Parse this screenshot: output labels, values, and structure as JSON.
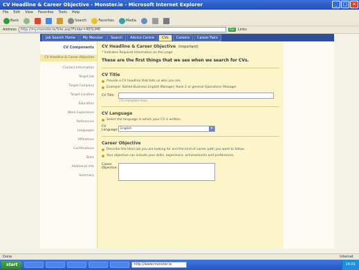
{
  "window": {
    "title": "CV Headline & Career Objective - Monster.ie - Microsoft Internet Explorer"
  },
  "menu": [
    "File",
    "Edit",
    "View",
    "Favorites",
    "Tools",
    "Help"
  ],
  "toolbar": {
    "back": "Back",
    "search": "Search",
    "favorites": "Favorites",
    "media": "Media"
  },
  "address": {
    "label": "Address",
    "value": "http://my.monster.ie/Site.asp?Folder=RESUME",
    "go": "Go",
    "links": "Links"
  },
  "nav": {
    "tabs": [
      "Job Search Home",
      "My Monster",
      "Search",
      "Advice Centre",
      "CVs",
      "Careers",
      "Career Fairs"
    ],
    "active_index": 4
  },
  "left": {
    "items": [
      "CV Components",
      "CV Headline & Career Objective",
      "Contact Information",
      "Target Job",
      "Target Company",
      "Target Location",
      "Education",
      "Work Experience",
      "References",
      "Languages",
      "Affiliations",
      "Certifications",
      "Skills",
      "Additional Info",
      "Summary"
    ],
    "current_index": 1
  },
  "main": {
    "section_title": "CV Headline & Career Objective",
    "section_hint": "(Important)",
    "required_note": "* Indicates Required Information on this page",
    "intro": "These are the first things that we see when we search for CVs.",
    "cv_title": {
      "heading": "CV Title",
      "bullets": [
        "Provide a CV headline that tells us who you are.",
        "Example: Skilled Business English Manager; Rank 2 or general Operations Manager"
      ],
      "field_label": "CV Title:",
      "hint": "(70 characters max)"
    },
    "cv_language": {
      "heading": "CV Language",
      "bullets": [
        "Select the language in which your CV is written."
      ],
      "field_label": "CV Language:",
      "selected": "English"
    },
    "career_objective": {
      "heading": "Career Objective",
      "bullets": [
        "Describe the ideal job you are looking for and the kind of career path you want to follow.",
        "Your objective can include your skills, experience, achievements and preferences."
      ],
      "field_label": "Career Objective:"
    }
  },
  "statusbar": {
    "text": "Done",
    "zone": "Internet"
  },
  "taskbar": {
    "start": "start",
    "address_item": "http://www.monster.ie",
    "clock": "14:01"
  },
  "colors": {
    "title_blue": "#1e4fb8",
    "nav_blue": "#2e4f9c",
    "form_yellow": "#fbf5c9",
    "bullet": "#c7a52d"
  }
}
